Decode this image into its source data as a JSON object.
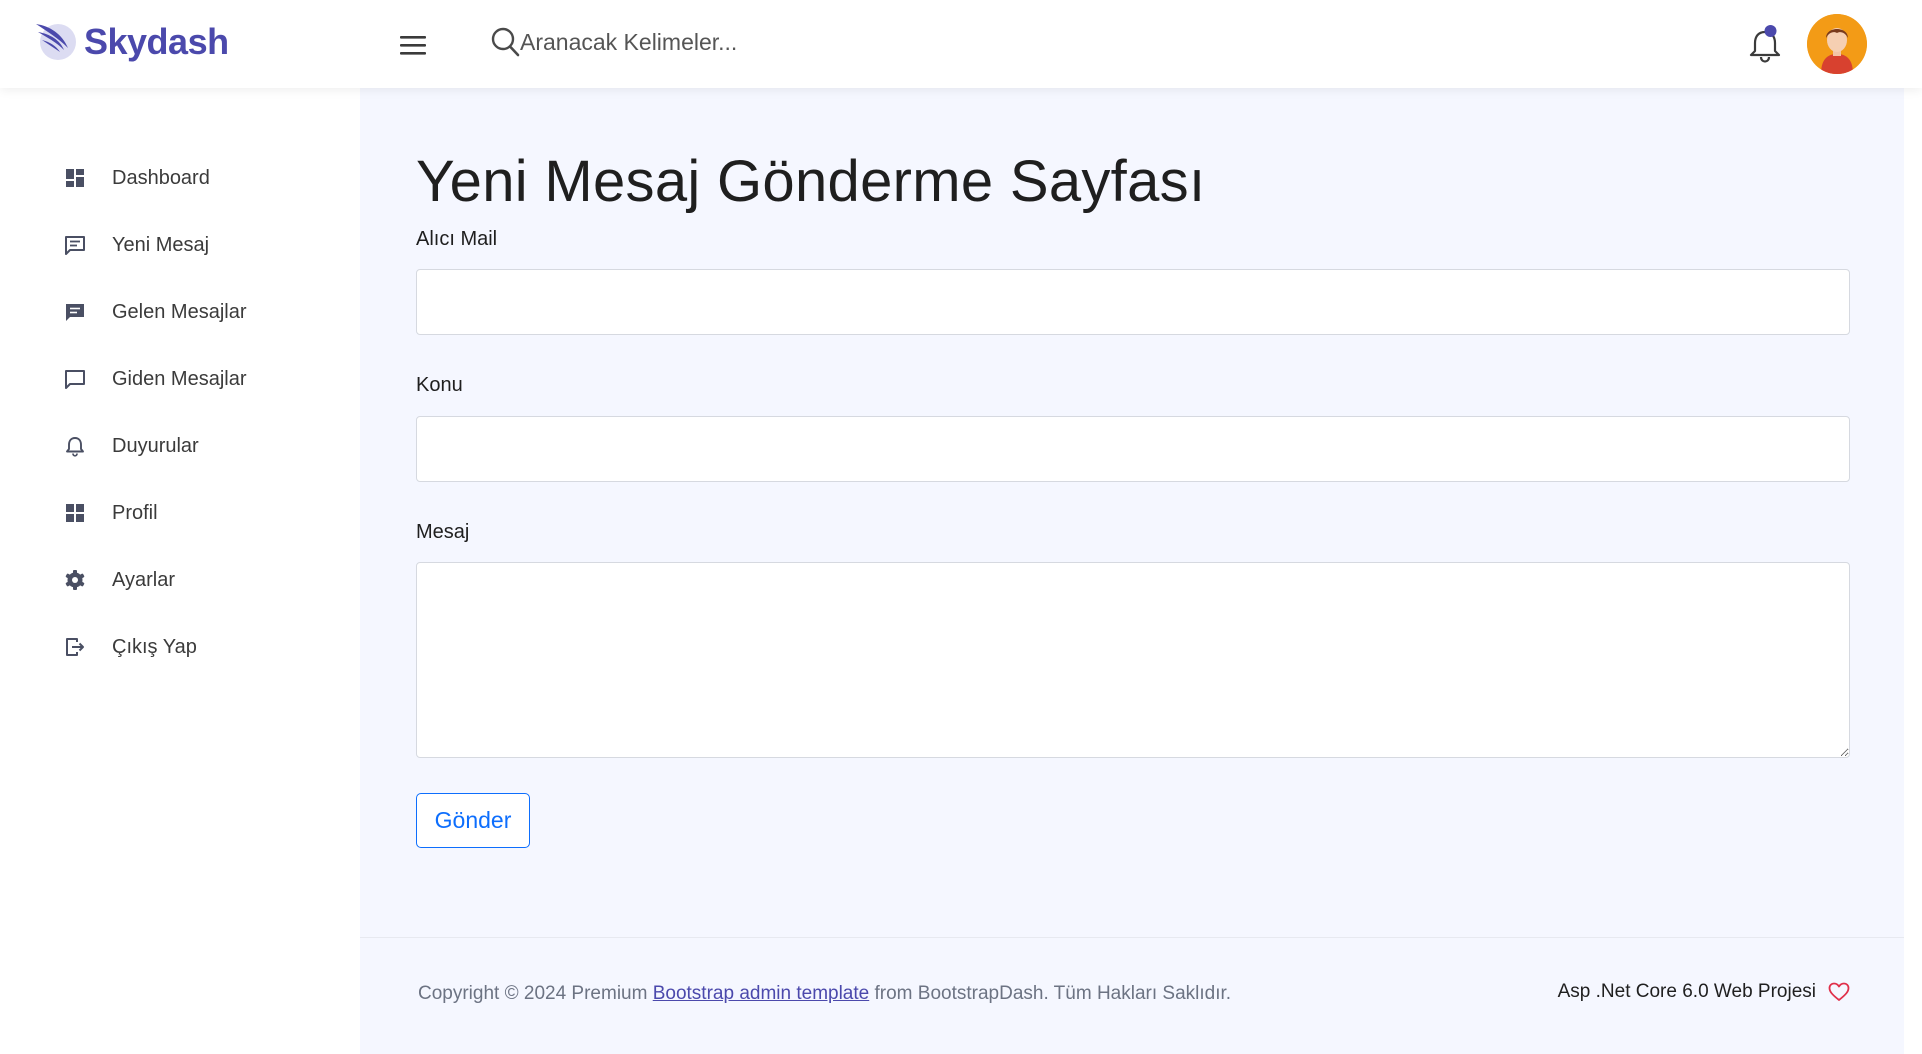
{
  "brand": {
    "name": "Skydash",
    "color": "#4b49ac"
  },
  "search": {
    "placeholder": "Aranacak Kelimeler..."
  },
  "sidebar": {
    "items": [
      {
        "label": "Dashboard",
        "icon": "dashboard-icon"
      },
      {
        "label": "Yeni Mesaj",
        "icon": "message-icon"
      },
      {
        "label": "Gelen Mesajlar",
        "icon": "inbox-message-icon"
      },
      {
        "label": "Giden Mesajlar",
        "icon": "chat-bubble-icon"
      },
      {
        "label": "Duyurular",
        "icon": "bell-icon"
      },
      {
        "label": "Profil",
        "icon": "grid-icon"
      },
      {
        "label": "Ayarlar",
        "icon": "gear-icon"
      },
      {
        "label": "Çıkış Yap",
        "icon": "logout-icon"
      }
    ]
  },
  "main": {
    "title": "Yeni Mesaj Gönderme Sayfası",
    "fields": {
      "recipient_label": "Alıcı Mail",
      "recipient_value": "",
      "subject_label": "Konu",
      "subject_value": "",
      "message_label": "Mesaj",
      "message_value": ""
    },
    "submit_label": "Gönder"
  },
  "footer": {
    "copyright_prefix": "Copyright © 2024 Premium ",
    "template_link": "Bootstrap admin template",
    "copyright_suffix": " from BootstrapDash. Tüm Hakları Saklıdır.",
    "project_text": "Asp .Net Core 6.0 Web Projesi"
  },
  "colors": {
    "accent": "#4b49ac",
    "button": "#0d6efd",
    "heart": "#e0304a",
    "content_bg": "#f5f7ff"
  }
}
